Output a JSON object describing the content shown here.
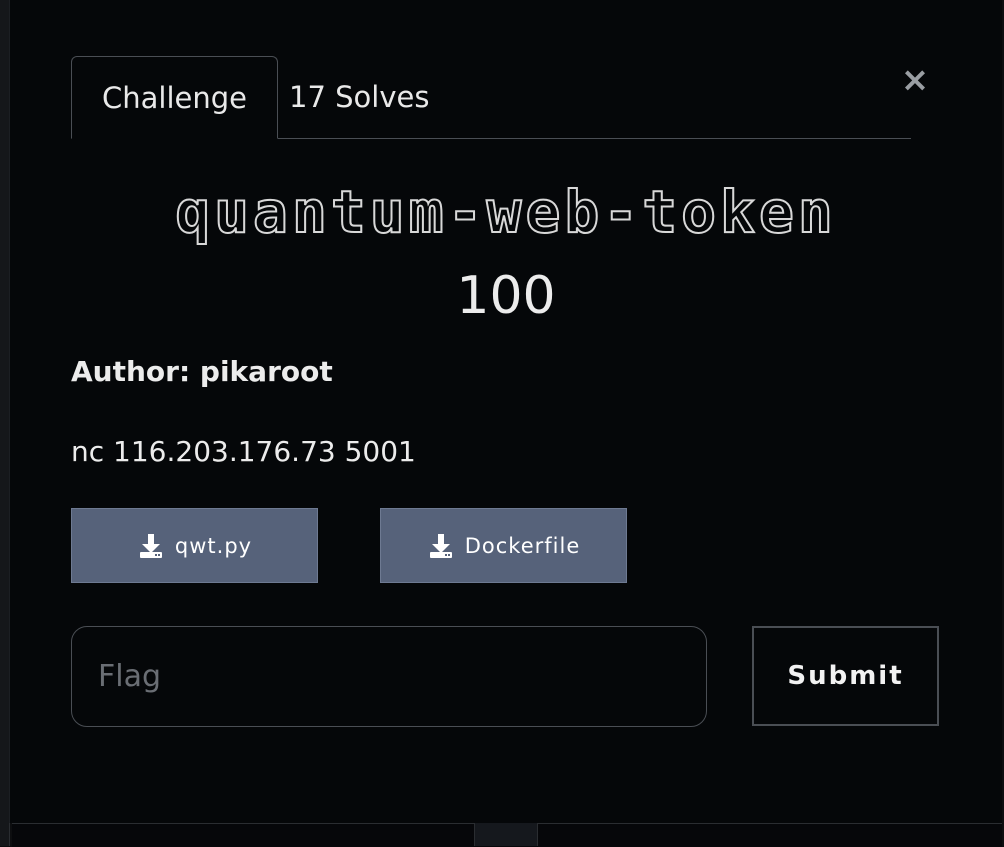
{
  "tabs": [
    {
      "label": "Challenge",
      "active": true
    },
    {
      "label": "17 Solves",
      "active": false
    }
  ],
  "close": {
    "icon": "close-icon",
    "glyph": "×"
  },
  "challenge": {
    "name": "quantum-web-token",
    "points": "100",
    "author": "Author: pikaroot",
    "description": "nc 116.203.176.73 5001"
  },
  "files": [
    {
      "label": "qwt.py",
      "icon": "download-icon"
    },
    {
      "label": "Dockerfile",
      "icon": "download-icon"
    }
  ],
  "flag_form": {
    "placeholder": "Flag",
    "value": "",
    "submit_label": "Submit"
  },
  "colors": {
    "background": "#050709",
    "file_button": "#56627a",
    "border": "#4a4e54",
    "text": "#ececec"
  }
}
